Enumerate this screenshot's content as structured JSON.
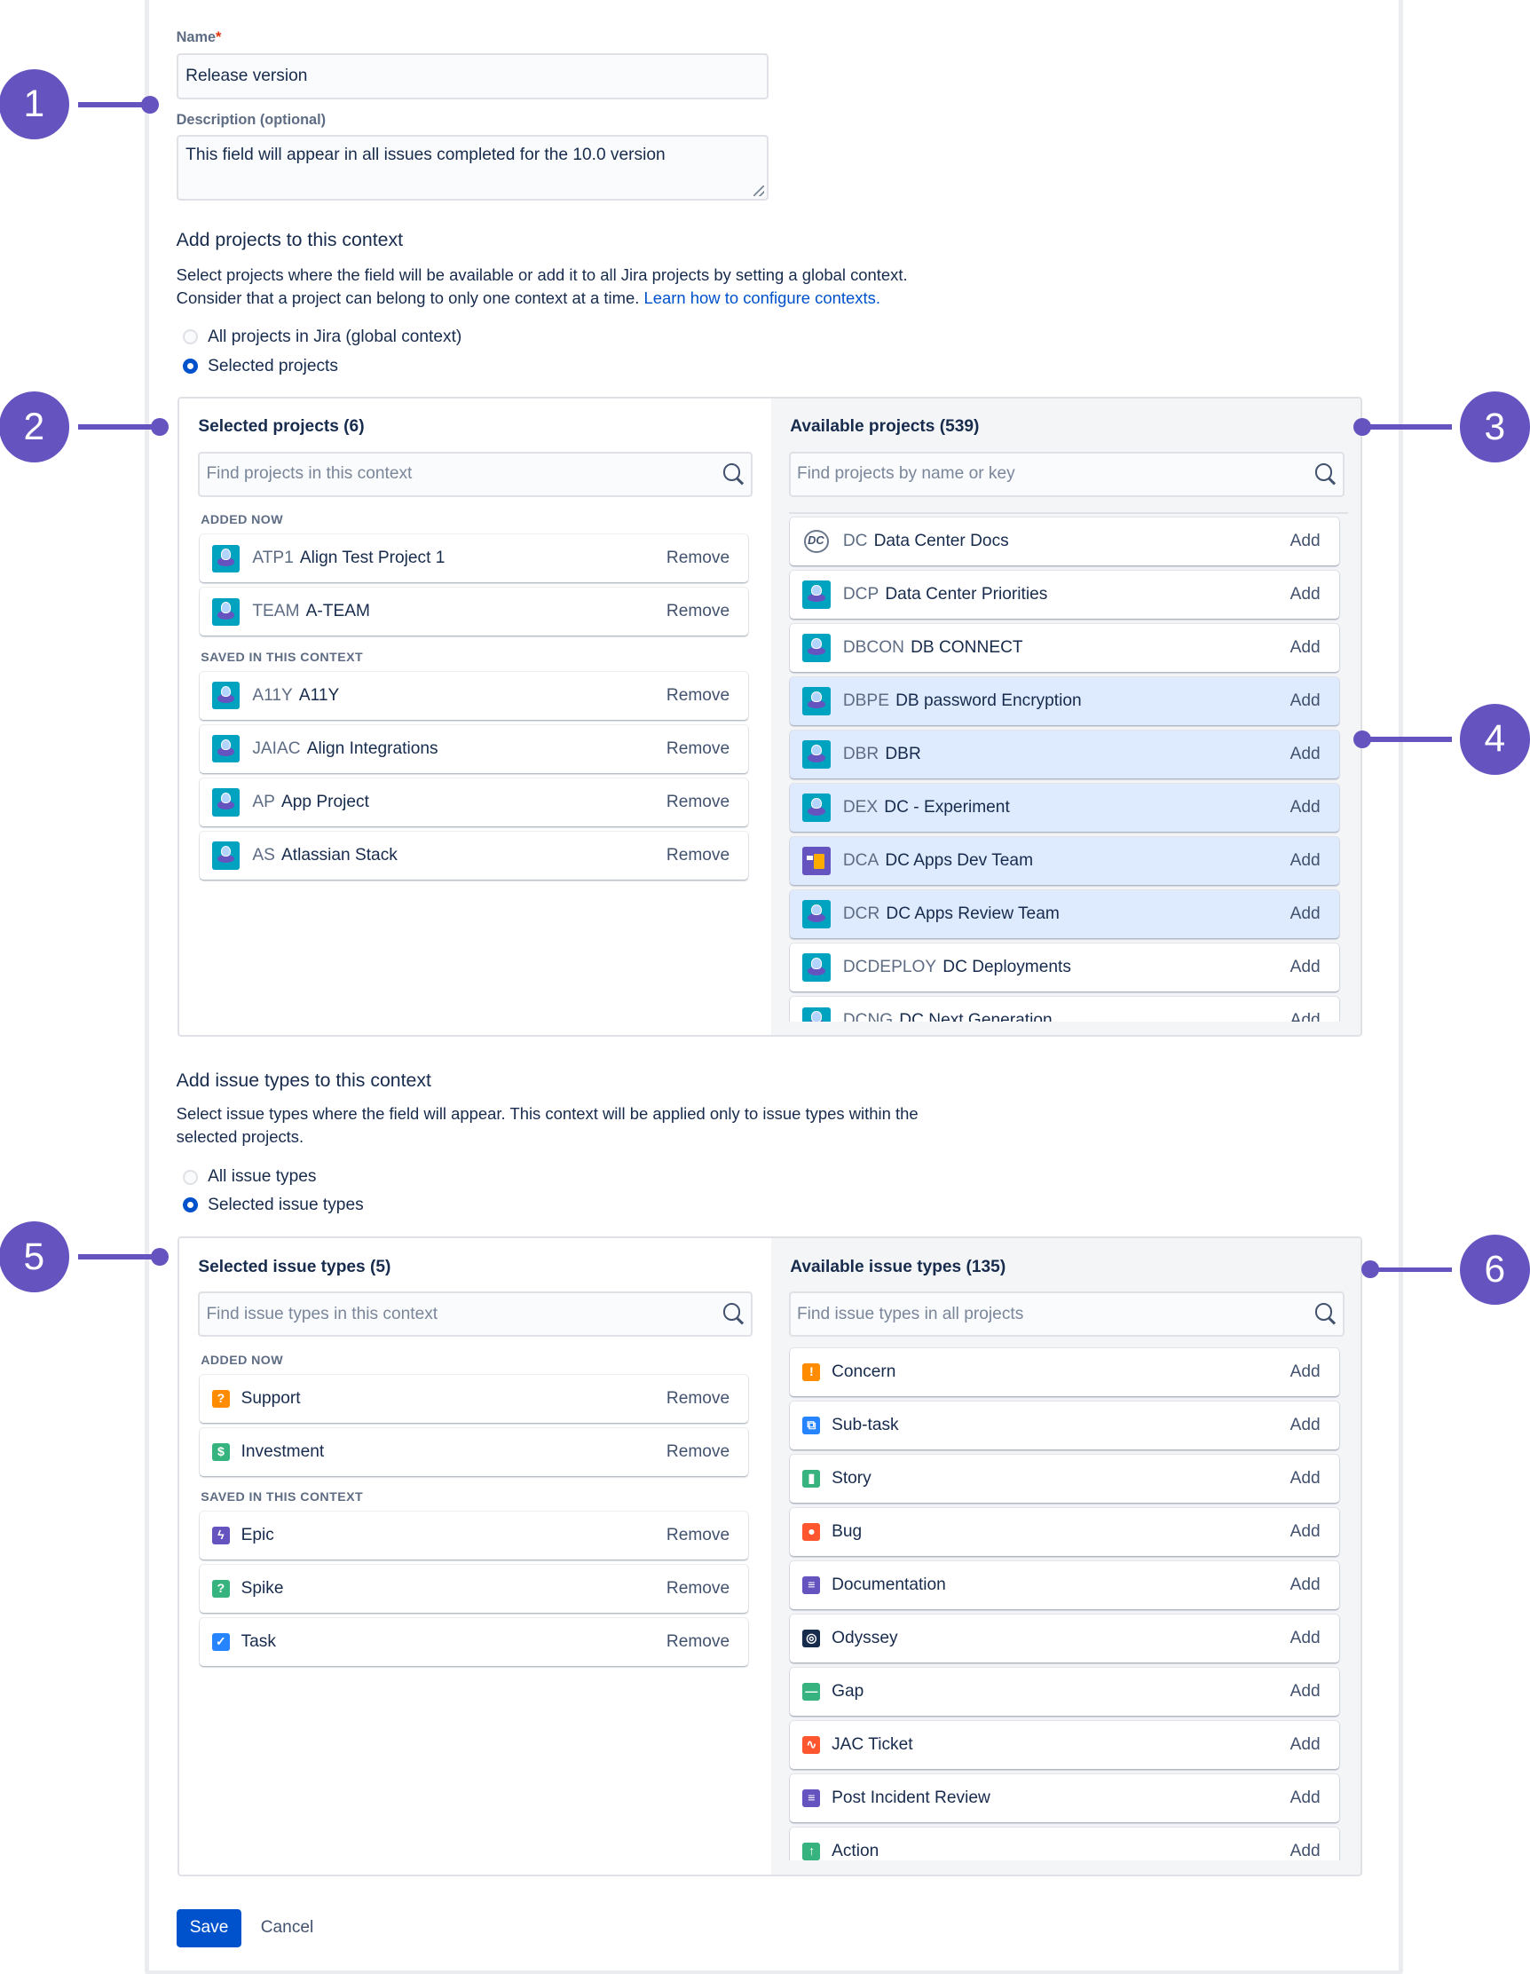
{
  "form": {
    "name_label": "Name",
    "required_mark": "*",
    "name_value": "Release version",
    "description_label": "Description (optional)",
    "description_value": "This field will appear in all issues completed for the 10.0 version"
  },
  "projects_section": {
    "heading": "Add projects to this context",
    "text_line1": "Select projects where the field will be available or add it to all Jira projects by setting a global context.",
    "text_line2": "Consider that a project can belong to only one context at a time.",
    "link": "Learn how to configure contexts.",
    "radio_all": "All projects in Jira (global context)",
    "radio_selected": "Selected projects",
    "selected_radio": "radio_selected",
    "selected_title": "Selected projects (6)",
    "selected_search_placeholder": "Find projects in this context",
    "added_now_label": "ADDED NOW",
    "saved_label": "SAVED IN THIS CONTEXT",
    "added_now": [
      {
        "key": "ATP1",
        "name": "Align Test Project 1",
        "action": "Remove",
        "icon": "project-avatar-icon"
      },
      {
        "key": "TEAM",
        "name": "A-TEAM",
        "action": "Remove",
        "icon": "project-avatar-icon"
      }
    ],
    "saved": [
      {
        "key": "A11Y",
        "name": "A11Y",
        "action": "Remove",
        "icon": "project-avatar-icon"
      },
      {
        "key": "JAIAC",
        "name": "Align Integrations",
        "action": "Remove",
        "icon": "project-avatar-icon"
      },
      {
        "key": "AP",
        "name": "App Project",
        "action": "Remove",
        "icon": "project-avatar-icon"
      },
      {
        "key": "AS",
        "name": "Atlassian Stack",
        "action": "Remove",
        "icon": "project-avatar-icon"
      }
    ],
    "available_title": "Available projects (539)",
    "available_search_placeholder": "Find projects by name or key",
    "available": [
      {
        "key": "DC",
        "name": "Data Center Docs",
        "action": "Add",
        "icon": "dc-logo-icon",
        "highlighted": false
      },
      {
        "key": "DCP",
        "name": "Data Center Priorities",
        "action": "Add",
        "icon": "project-avatar-icon",
        "highlighted": false
      },
      {
        "key": "DBCON",
        "name": "DB CONNECT",
        "action": "Add",
        "icon": "project-avatar-icon",
        "highlighted": false
      },
      {
        "key": "DBPE",
        "name": "DB password Encryption",
        "action": "Add",
        "icon": "project-avatar-icon",
        "highlighted": true
      },
      {
        "key": "DBR",
        "name": "DBR",
        "action": "Add",
        "icon": "project-avatar-icon",
        "highlighted": true
      },
      {
        "key": "DEX",
        "name": "DC - Experiment",
        "action": "Add",
        "icon": "project-avatar-icon",
        "highlighted": true
      },
      {
        "key": "DCA",
        "name": "DC Apps Dev Team",
        "action": "Add",
        "icon": "drill-avatar-icon",
        "highlighted": true
      },
      {
        "key": "DCR",
        "name": "DC Apps Review Team",
        "action": "Add",
        "icon": "project-avatar-icon",
        "highlighted": true
      },
      {
        "key": "DCDEPLOY",
        "name": "DC Deployments",
        "action": "Add",
        "icon": "project-avatar-icon",
        "highlighted": false
      },
      {
        "key": "DCNG",
        "name": "DC Next Generation",
        "action": "Add",
        "icon": "project-avatar-icon",
        "highlighted": false
      }
    ]
  },
  "issue_types_section": {
    "heading": "Add issue types to this context",
    "text_line1": "Select issue types where the field will appear. This context will be applied only to issue types within the",
    "text_line2": "selected projects.",
    "radio_all": "All issue types",
    "radio_selected": "Selected issue types",
    "selected_radio": "radio_selected",
    "selected_title": "Selected issue types (5)",
    "selected_search_placeholder": "Find issue types in this context",
    "added_now_label": "ADDED NOW",
    "saved_label": "SAVED IN THIS CONTEXT",
    "added_now": [
      {
        "name": "Support",
        "action": "Remove",
        "icon": "question-icon",
        "color": "#ff8b00",
        "glyph": "?"
      },
      {
        "name": "Investment",
        "action": "Remove",
        "icon": "dollar-icon",
        "color": "#36b37e",
        "glyph": "$"
      }
    ],
    "saved": [
      {
        "name": "Epic",
        "action": "Remove",
        "icon": "lightning-icon",
        "color": "#6554c0",
        "glyph": "ϟ"
      },
      {
        "name": "Spike",
        "action": "Remove",
        "icon": "question-icon",
        "color": "#36b37e",
        "glyph": "?"
      },
      {
        "name": "Task",
        "action": "Remove",
        "icon": "checkbox-icon",
        "color": "#2684ff",
        "glyph": "✓"
      }
    ],
    "available_title": "Available issue types (135)",
    "available_search_placeholder": "Find issue types in all projects",
    "available": [
      {
        "name": "Concern",
        "action": "Add",
        "icon": "exclamation-icon",
        "color": "#ff8b00",
        "glyph": "!"
      },
      {
        "name": "Sub-task",
        "action": "Add",
        "icon": "subtask-icon",
        "color": "#2684ff",
        "glyph": "⧉"
      },
      {
        "name": "Story",
        "action": "Add",
        "icon": "bookmark-icon",
        "color": "#36b37e",
        "glyph": "▮"
      },
      {
        "name": "Bug",
        "action": "Add",
        "icon": "bug-icon",
        "color": "#ff5630",
        "glyph": "●"
      },
      {
        "name": "Documentation",
        "action": "Add",
        "icon": "document-icon",
        "color": "#6554c0",
        "glyph": "≡"
      },
      {
        "name": "Odyssey",
        "action": "Add",
        "icon": "ring-icon",
        "color": "#172b4d",
        "glyph": "◎"
      },
      {
        "name": "Gap",
        "action": "Add",
        "icon": "minus-icon",
        "color": "#36b37e",
        "glyph": "—"
      },
      {
        "name": "JAC Ticket",
        "action": "Add",
        "icon": "pulse-icon",
        "color": "#ff5630",
        "glyph": "∿"
      },
      {
        "name": "Post Incident Review",
        "action": "Add",
        "icon": "document-icon",
        "color": "#6554c0",
        "glyph": "≡"
      },
      {
        "name": "Action",
        "action": "Add",
        "icon": "arrow-up-icon",
        "color": "#36b37e",
        "glyph": "↑"
      }
    ]
  },
  "footer": {
    "save_label": "Save",
    "cancel_label": "Cancel"
  },
  "annotations": [
    "1",
    "2",
    "3",
    "4",
    "5",
    "6"
  ],
  "colors": {
    "annotation": "#6554c0",
    "primary": "#0052cc",
    "highlight": "#deebff"
  }
}
